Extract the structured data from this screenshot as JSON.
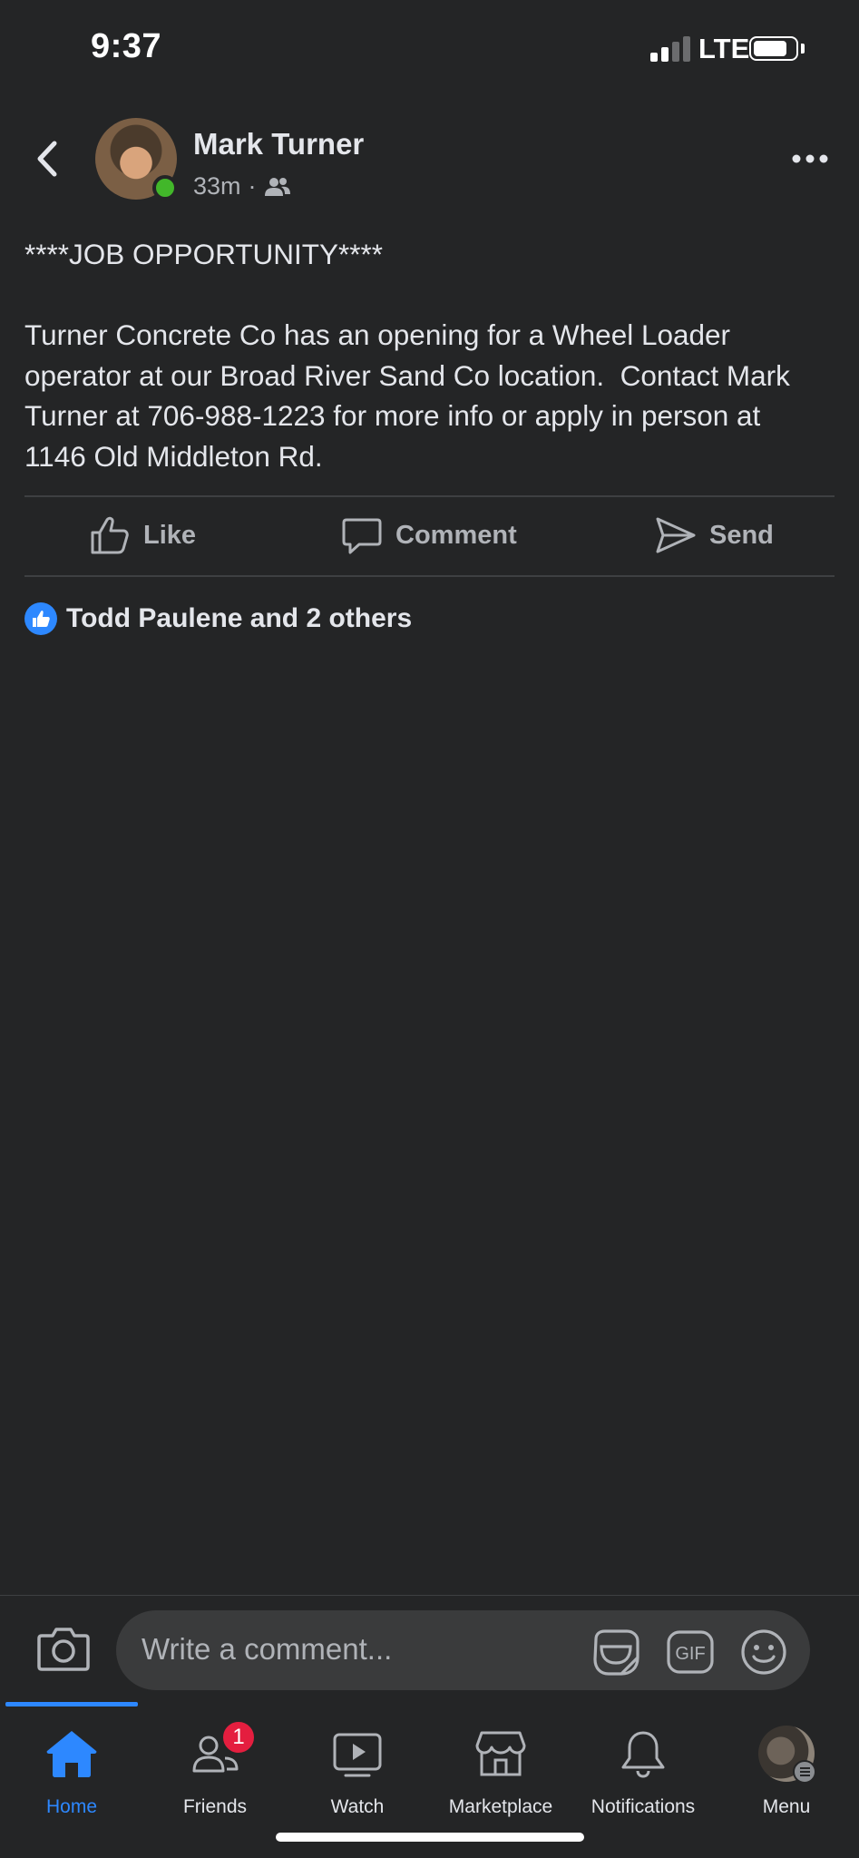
{
  "status_bar": {
    "time": "9:37",
    "network": "LTE"
  },
  "post": {
    "author": "Mark Turner",
    "time_ago": "33m",
    "separator": "·",
    "audience_icon": "friends-icon",
    "body": "****JOB OPPORTUNITY****\n\nTurner Concrete Co has an opening for a Wheel Loader operator at our Broad River Sand Co location.  Contact Mark Turner at 706-988-1223 for more info or apply in person at 1146 Old Middleton Rd."
  },
  "actions": {
    "like": "Like",
    "comment": "Comment",
    "send": "Send"
  },
  "reactions": {
    "text": "Todd Paulene and 2 others",
    "icon": "like-icon"
  },
  "comment_box": {
    "placeholder": "Write a comment..."
  },
  "tab_bar": {
    "tabs": [
      {
        "label": "Home",
        "icon": "home-icon",
        "active": true
      },
      {
        "label": "Friends",
        "icon": "friends-icon",
        "badge": "1"
      },
      {
        "label": "Watch",
        "icon": "watch-icon"
      },
      {
        "label": "Marketplace",
        "icon": "marketplace-icon"
      },
      {
        "label": "Notifications",
        "icon": "bell-icon"
      },
      {
        "label": "Menu",
        "icon": "profile-avatar"
      }
    ]
  },
  "colors": {
    "background": "#242526",
    "accent": "#2d88ff",
    "online": "#42b72a",
    "badge": "#e41e3f"
  }
}
